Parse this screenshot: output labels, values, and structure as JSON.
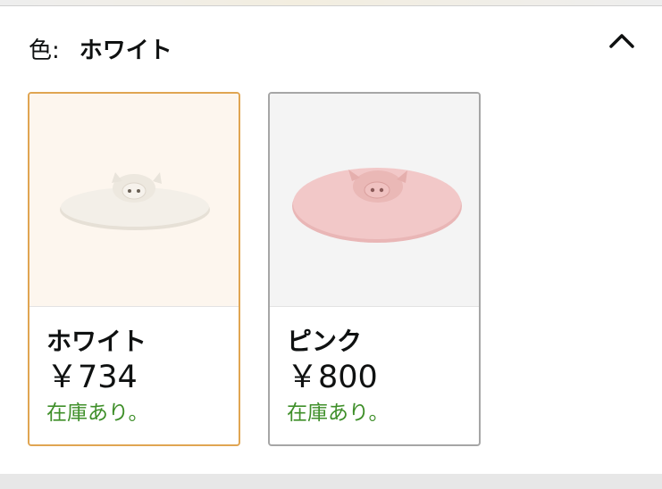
{
  "selector": {
    "label": "色:",
    "selected_value": "ホワイト",
    "collapse_icon": "chevron-up-icon"
  },
  "options": [
    {
      "name": "ホワイト",
      "price": "￥734",
      "stock": "在庫あり。",
      "selected": true,
      "image": "white-pig-lid",
      "colors": {
        "background": "#fdf6ee",
        "lid": "#f3efe8"
      }
    },
    {
      "name": "ピンク",
      "price": "￥800",
      "stock": "在庫あり。",
      "selected": false,
      "image": "pink-pig-lid",
      "colors": {
        "background": "#f4f4f4",
        "lid": "#f2c8c8"
      }
    }
  ],
  "colors": {
    "selected_border": "#e0a552",
    "border": "#a6a6a6",
    "stock": "#3f8f2a",
    "text": "#0f1111"
  }
}
